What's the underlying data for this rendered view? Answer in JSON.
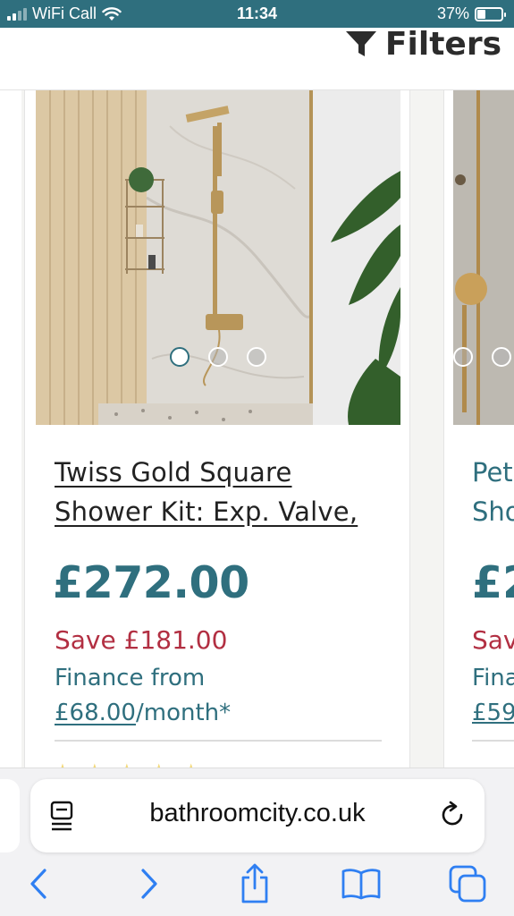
{
  "status": {
    "carrier": "WiFi Call",
    "time": "11:34",
    "battery": "37%"
  },
  "header": {
    "filters_label": "Filters"
  },
  "product": {
    "title_line1": "Twiss Gold Square",
    "title_line2": "Shower Kit: Exp. Valve,",
    "price": "£272.00",
    "save": "Save £181.00",
    "finance_prefix": "Finance from",
    "finance_amount": "£68.00",
    "finance_suffix": "/month*",
    "image_count": 3,
    "active_image": 1
  },
  "next_product": {
    "title_line1": "Pet",
    "title_line2": "Sho",
    "price": "£2",
    "save": "Sav",
    "finance_prefix": "Fina",
    "finance_amount": "£59"
  },
  "browser": {
    "url": "bathroomcity.co.uk"
  },
  "colors": {
    "brand": "#2f6f7e",
    "sale": "#b22f42"
  }
}
